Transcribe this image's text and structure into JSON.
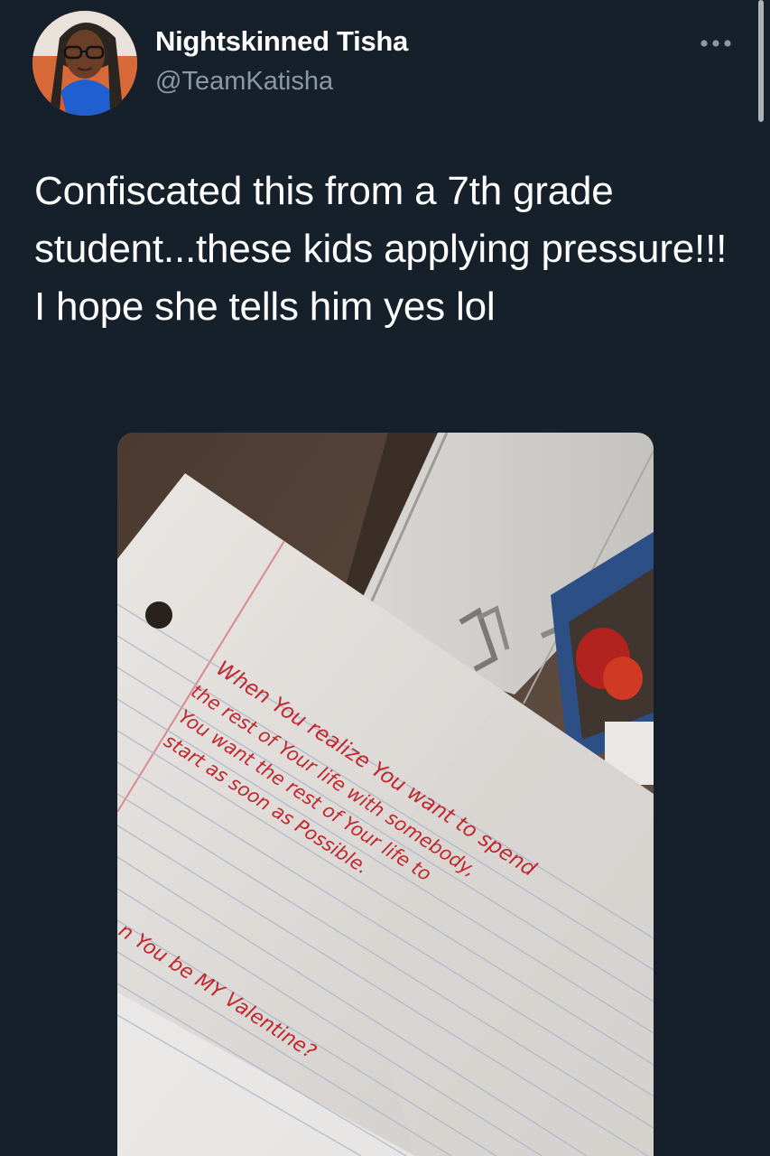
{
  "tweet": {
    "display_name": "Nightskinned Tisha",
    "handle": "@TeamKatisha",
    "text": "Confiscated this from a 7th grade student...these kids applying pressure!!! I hope she tells him yes lol",
    "more_icon": "more-horizontal-icon"
  },
  "media": {
    "note_lines": [
      "When You realize You want to spend",
      "the rest of Your life with somebody,",
      "You want the rest of Your life to",
      "start as soon as Possible.",
      "n  You be MY Valentine?"
    ]
  },
  "colors": {
    "background": "#15202b",
    "text": "#ffffff",
    "secondary_text": "#8b98a5",
    "ink_red": "#c1272d"
  }
}
